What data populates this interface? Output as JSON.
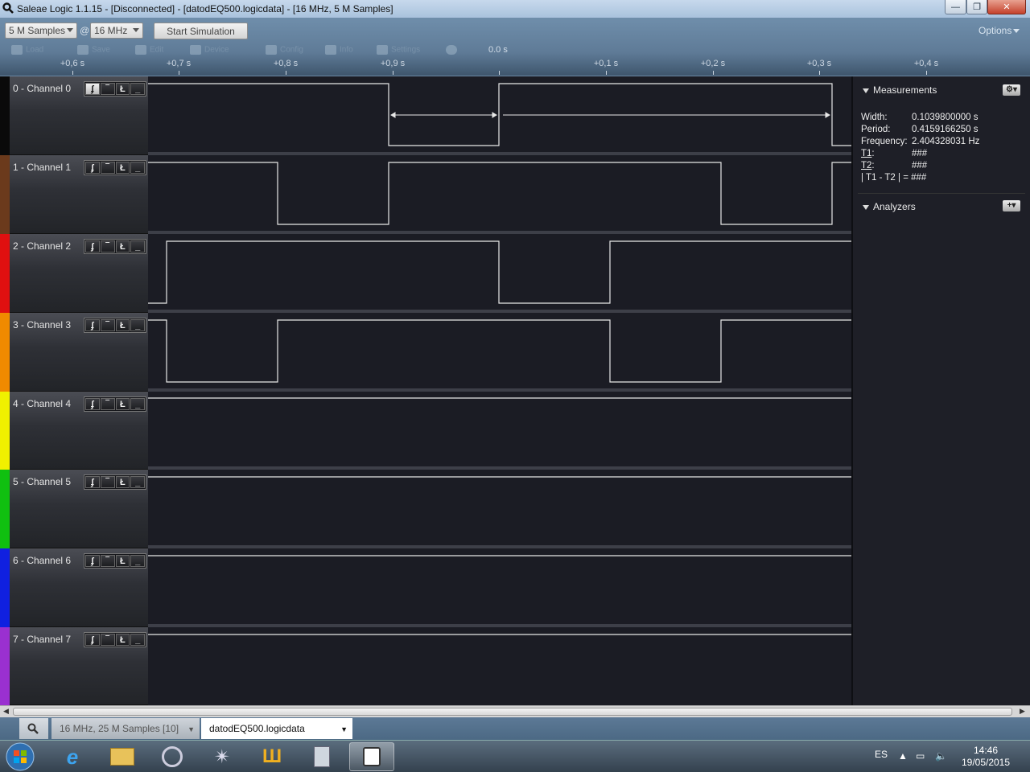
{
  "window": {
    "title": "Saleae Logic 1.1.15 - [Disconnected] - [datodEQ500.logicdata] - [16 MHz, 5 M Samples]",
    "min": "—",
    "max": "❐",
    "close": "✕"
  },
  "toolbar": {
    "samples": "5 M Samples",
    "at": "@",
    "rate": "16 MHz",
    "start": "Start Simulation",
    "options": "Options",
    "faded_tools": [
      "Load",
      "Save",
      "Edit",
      "Device",
      "Config",
      "Info",
      "Settings"
    ]
  },
  "timeline": {
    "zero": "0.0 s",
    "ticks": [
      "+0,6 s",
      "+0,7 s",
      "+0,8 s",
      "+0,9 s",
      "+0,1 s",
      "+0,2 s",
      "+0,3 s",
      "+0,4 s"
    ]
  },
  "channels": [
    {
      "name": "0 - Channel 0",
      "color": "#0a0a0a"
    },
    {
      "name": "1 - Channel 1",
      "color": "#6b3a1c"
    },
    {
      "name": "2 - Channel 2",
      "color": "#e01010"
    },
    {
      "name": "3 - Channel 3",
      "color": "#f08a00"
    },
    {
      "name": "4 - Channel 4",
      "color": "#f0f000"
    },
    {
      "name": "5 - Channel 5",
      "color": "#10c010"
    },
    {
      "name": "6 - Channel 6",
      "color": "#1020e0"
    },
    {
      "name": "7 - Channel 7",
      "color": "#9a30d0"
    }
  ],
  "trigger_buttons": [
    "ʄ",
    "‾",
    "Ł",
    "_"
  ],
  "measurements": {
    "title": "Measurements",
    "width_label": "Width:",
    "width": "0.1039800000 s",
    "period_label": "Period:",
    "period": "0.4159166250 s",
    "freq_label": "Frequency:",
    "freq": "2.404328031 Hz",
    "t1_label": "T1",
    "t1": "###",
    "t2_label": "T2",
    "t2": "###",
    "diff_label": "| T1 - T2 | =",
    "diff": "###"
  },
  "analyzers": {
    "title": "Analyzers"
  },
  "tabs": [
    {
      "label": "16 MHz, 25 M Samples [10]"
    },
    {
      "label": "datodEQ500.logicdata"
    }
  ],
  "taskbar": {
    "lang": "ES",
    "time": "14:46",
    "date": "19/05/2015"
  }
}
